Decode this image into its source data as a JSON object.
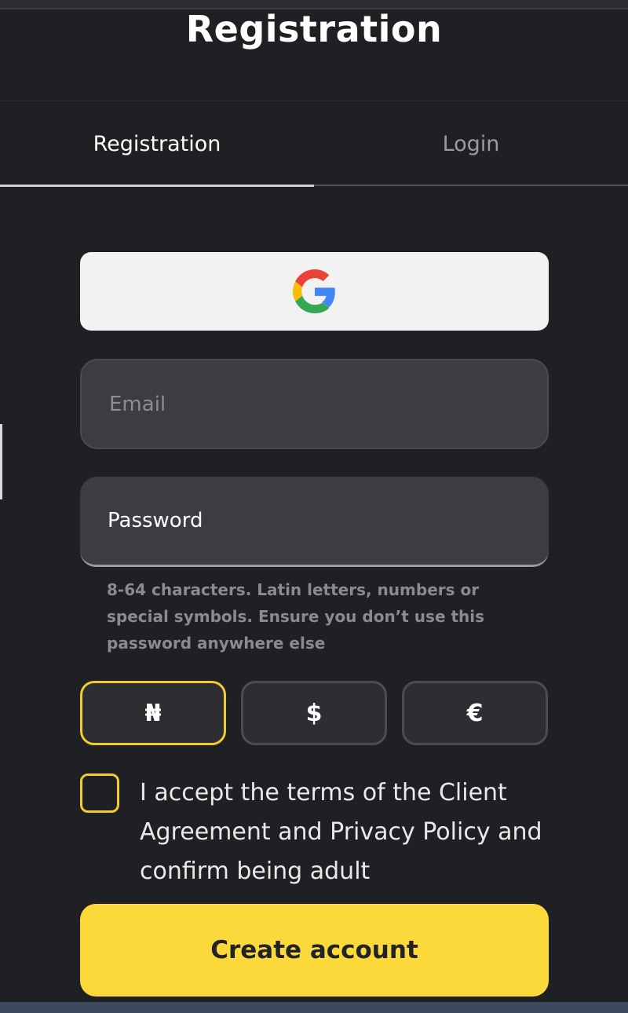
{
  "header": {
    "title": "Registration"
  },
  "tabs": [
    {
      "label": "Registration",
      "active": true
    },
    {
      "label": "Login",
      "active": false
    }
  ],
  "google_button": {
    "icon": "google-icon"
  },
  "form": {
    "email_placeholder": "Email",
    "password_placeholder": "Password",
    "password_hint": "8-64 characters. Latin letters, numbers or special symbols. Ensure you don’t use this password anywhere else"
  },
  "currencies": [
    {
      "symbol": "₦",
      "selected": true
    },
    {
      "symbol": "$",
      "selected": false
    },
    {
      "symbol": "€",
      "selected": false
    }
  ],
  "terms": {
    "text": "I accept the terms of the Client Agreement and Privacy Policy and confirm being adult",
    "checked": false
  },
  "submit": {
    "label": "Create account"
  },
  "colors": {
    "accent": "#fbd93b",
    "background": "#1f2023",
    "field": "#3c3d42"
  }
}
